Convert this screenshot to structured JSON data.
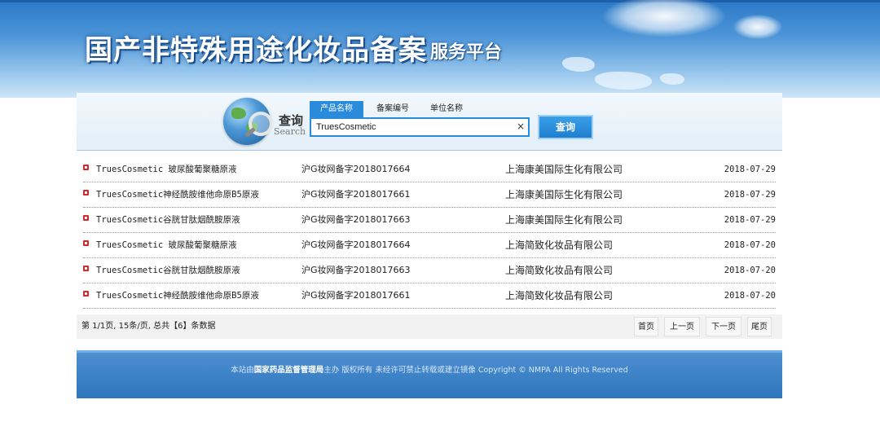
{
  "header": {
    "title": "国产非特殊用途化妆品备案",
    "subtitle": "服务平台"
  },
  "search": {
    "label": "查询",
    "label_en": "Search",
    "tabs": [
      "产品名称",
      "备案编号",
      "单位名称"
    ],
    "active_tab": 0,
    "input_value": "TruesCosmetic",
    "clear_symbol": "×",
    "button_label": "查询"
  },
  "results": [
    {
      "name": "TruesCosmetic 玻尿酸葡聚糖原液",
      "code": "沪G妆网备字2018017664",
      "company": "上海康美国际生化有限公司",
      "date": "2018-07-29"
    },
    {
      "name": "TruesCosmetic神经酰胺维他命原B5原液",
      "code": "沪G妆网备字2018017661",
      "company": "上海康美国际生化有限公司",
      "date": "2018-07-29"
    },
    {
      "name": "TruesCosmetic谷胱甘肽烟酰胺原液",
      "code": "沪G妆网备字2018017663",
      "company": "上海康美国际生化有限公司",
      "date": "2018-07-29"
    },
    {
      "name": "TruesCosmetic 玻尿酸葡聚糖原液",
      "code": "沪G妆网备字2018017664",
      "company": "上海简致化妆品有限公司",
      "date": "2018-07-20"
    },
    {
      "name": "TruesCosmetic谷胱甘肽烟酰胺原液",
      "code": "沪G妆网备字2018017663",
      "company": "上海简致化妆品有限公司",
      "date": "2018-07-20"
    },
    {
      "name": "TruesCosmetic神经酰胺维他命原B5原液",
      "code": "沪G妆网备字2018017661",
      "company": "上海简致化妆品有限公司",
      "date": "2018-07-20"
    }
  ],
  "pagination": {
    "info": "第 1/1页, 15条/页, 总共【6】条数据",
    "first": "首页",
    "prev": "上一页",
    "next": "下一页",
    "last": "尾页"
  },
  "footer": {
    "prefix": "本站由",
    "org": "国家药品监督管理局",
    "suffix": "主办 版权所有 未经许可禁止转载或建立镜像 Copyright © NMPA All Rights Reserved"
  }
}
